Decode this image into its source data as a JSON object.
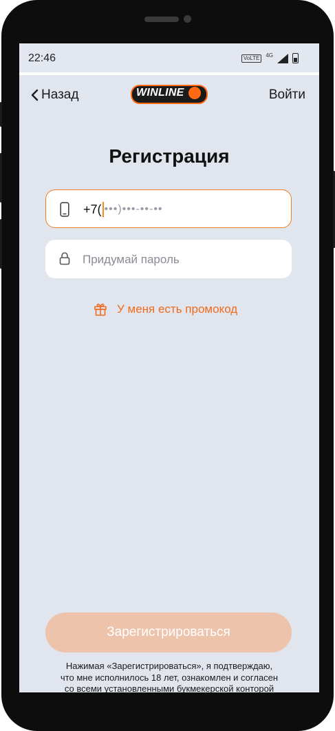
{
  "status_bar": {
    "time": "22:46",
    "volte": "VoLTE",
    "network": "4G"
  },
  "header": {
    "back_label": "Назад",
    "logo_text": "WINLINE",
    "login_label": "Войти"
  },
  "page": {
    "title": "Регистрация"
  },
  "form": {
    "phone_prefix": "+7(",
    "phone_mask": "•••)•••-••-••",
    "password_placeholder": "Придумай пароль",
    "promo_label": "У меня есть промокод",
    "register_label": "Зарегистрироваться",
    "disclaimer_lines": [
      "Нажимая «Зарегистрироваться», я подтверждаю,",
      "что мне исполнилось 18 лет, ознакомлен и согласен",
      "со всеми установленными букмекерской конторой"
    ]
  },
  "colors": {
    "accent": "#f06a1c",
    "background": "#e1e5ee",
    "button_disabled": "#eec3ac",
    "logo_bg": "#1b1b1b"
  },
  "icons": {
    "back": "chevron-left-icon",
    "phone": "smartphone-icon",
    "password": "lock-icon",
    "promo": "gift-icon",
    "signal": "signal-icon",
    "battery": "battery-icon"
  }
}
